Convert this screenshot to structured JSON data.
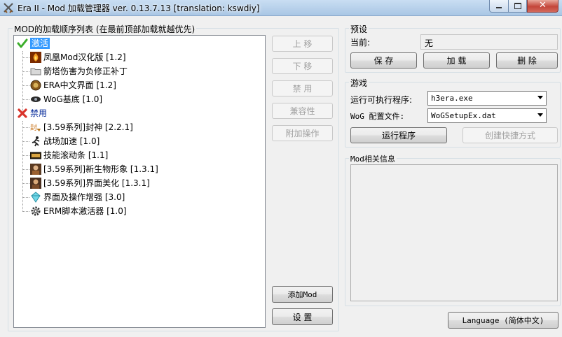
{
  "window": {
    "title": "Era II - Mod 加载管理器 ver. 0.13.7.13 [translation: kswdiy]",
    "min_glyph": "",
    "max_glyph": "",
    "close_glyph": "✕"
  },
  "mod_list": {
    "group_title": "MOD的加载顺序列表 (在最前顶部加载就越优先)",
    "enabled_label": "激活",
    "disabled_label": "禁用",
    "enabled_items": [
      {
        "label": "凤凰Mod汉化版 [1.2]",
        "icon": "phoenix-icon"
      },
      {
        "label": "箭塔伤害为负修正补丁",
        "icon": "folder-icon"
      },
      {
        "label": "ERA中文界面 [1.2]",
        "icon": "shield-icon"
      },
      {
        "label": "WoG基底 [1.0]",
        "icon": "eye-icon"
      }
    ],
    "disabled_items": [
      {
        "label": "[3.59系列]封神 [2.2.1]",
        "icon": "seal-icon"
      },
      {
        "label": "战场加速 [1.0]",
        "icon": "runner-icon"
      },
      {
        "label": "技能滚动条 [1.1]",
        "icon": "scroll-bar-icon"
      },
      {
        "label": "[3.59系列]新生物形象 [1.3.1]",
        "icon": "creature-portrait-icon"
      },
      {
        "label": "[3.59系列]界面美化 [1.3.1]",
        "icon": "interface-portrait-icon"
      },
      {
        "label": "界面及操作增强 [3.0]",
        "icon": "gem-icon"
      },
      {
        "label": "ERM脚本激活器 [1.0]",
        "icon": "gear-icon"
      }
    ]
  },
  "actions": {
    "move_up": "上 移",
    "move_down": "下 移",
    "disable": "禁 用",
    "compatibility": "兼容性",
    "extra_ops": "附加操作",
    "add_mod": "添加Mod",
    "settings": "设 置"
  },
  "preset": {
    "group_title": "预设",
    "current_label": "当前:",
    "current_value": "无",
    "save": "保 存",
    "load": "加 载",
    "delete": "删 除"
  },
  "game": {
    "group_title": "游戏",
    "exe_label": "运行可执行程序:",
    "exe_value": "h3era.exe",
    "config_label": "WoG 配置文件:",
    "config_value": "WoGSetupEx.dat",
    "run": "运行程序",
    "shortcut": "创建快捷方式"
  },
  "mod_info": {
    "group_title": "Mod相关信息"
  },
  "language_button": "Language (简体中文)",
  "colors": {
    "selection": "#3399ff",
    "enabled_check": "#3cae2b",
    "disabled_x": "#d9342b",
    "disabled_text": "#a0a0a0"
  }
}
